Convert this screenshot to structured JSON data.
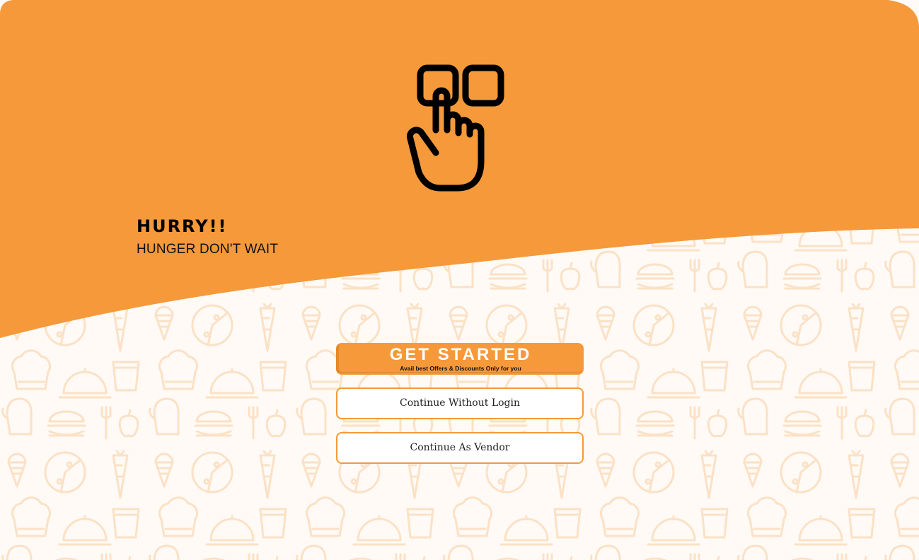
{
  "theme": {
    "accent": "#f5993a",
    "pattern_color": "#fbe3cb",
    "background": "#fffaf5",
    "text": "#000000"
  },
  "hero": {
    "icon": "tap-hand-icon",
    "headline": "HURRY!!",
    "subline": "HUNGER DON'T WAIT"
  },
  "actions": {
    "get_started": {
      "label": "GET STARTED",
      "sublabel": "Avail best Offers & Discounts Only for you"
    },
    "continue_without_login": "Continue Without Login",
    "continue_as_vendor": "Continue As Vendor"
  },
  "background_pattern": {
    "icon": "food-doodle-pattern"
  }
}
